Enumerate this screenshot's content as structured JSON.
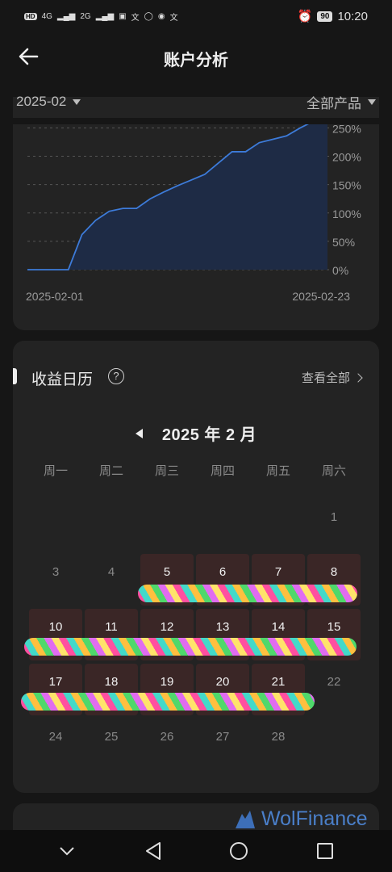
{
  "status_bar": {
    "left_labels": [
      "HD",
      "4G",
      "2G"
    ],
    "battery": "90",
    "time": "10:20"
  },
  "header": {
    "title": "账户分析"
  },
  "filters": {
    "month": "2025-02",
    "product": "全部产品"
  },
  "chart_data": {
    "type": "area",
    "x": [
      "2025-02-01",
      "2025-02-02",
      "2025-02-03",
      "2025-02-04",
      "2025-02-05",
      "2025-02-06",
      "2025-02-07",
      "2025-02-08",
      "2025-02-09",
      "2025-02-10",
      "2025-02-11",
      "2025-02-12",
      "2025-02-13",
      "2025-02-14",
      "2025-02-15",
      "2025-02-16",
      "2025-02-17",
      "2025-02-18",
      "2025-02-19",
      "2025-02-20",
      "2025-02-21",
      "2025-02-22",
      "2025-02-23"
    ],
    "y": [
      0,
      0,
      0,
      0,
      62,
      87,
      103,
      108,
      108,
      125,
      137,
      148,
      158,
      168,
      188,
      208,
      208,
      224,
      230,
      236,
      250,
      262,
      262
    ],
    "x_tick_labels": [
      "2025-02-01",
      "2025-02-23"
    ],
    "y_tick_labels": [
      "0%",
      "50%",
      "100%",
      "150%",
      "200%",
      "250%"
    ],
    "ylim": [
      0,
      262
    ],
    "line_color": "#3d7bd9",
    "fill_color": "#1e2b45",
    "grid": true
  },
  "calendar": {
    "title": "收益日历",
    "help_symbol": "?",
    "view_all": "查看全部",
    "month_label": "2025 年 2 月",
    "weekdays": [
      "周一",
      "周二",
      "周三",
      "周四",
      "周五",
      "周六"
    ],
    "rows": [
      [
        null,
        null,
        null,
        null,
        null,
        "1"
      ],
      [
        "3",
        "4",
        "5",
        "6",
        "7",
        "8"
      ],
      [
        "10",
        "11",
        "12",
        "13",
        "14",
        "15"
      ],
      [
        "17",
        "18",
        "19",
        "20",
        "21",
        "22"
      ],
      [
        "24",
        "25",
        "26",
        "27",
        "28",
        null
      ]
    ],
    "active_days": [
      "5",
      "6",
      "7",
      "8",
      "10",
      "11",
      "12",
      "13",
      "14",
      "15",
      "17",
      "18",
      "19",
      "20",
      "21"
    ],
    "active_color": "#3a2626"
  },
  "watermark": {
    "text": "WolFinance"
  }
}
